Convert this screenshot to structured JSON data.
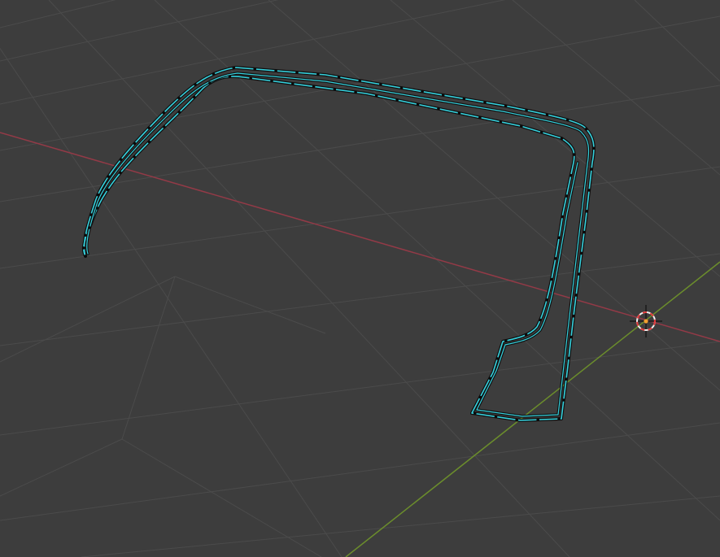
{
  "viewport": {
    "view": "3d-viewport",
    "mode": "edit",
    "selection": "all-edges-selected"
  },
  "colors": {
    "background": "#3d3d3d",
    "grid_line": "#4b4b4b",
    "x_axis": "#933a47",
    "y_axis": "#6b8d2c",
    "selected_edge": "#36d0dc",
    "edge_outline": "#101010",
    "vertex": "#0b0b0b",
    "cursor_ring_red": "#e23a3a",
    "cursor_ring_white": "#f0f0f0",
    "cursor_center": "#f0a030",
    "cursor_crosshair": "#1a1a1a"
  },
  "icons": {
    "cursor": "3d-cursor-icon"
  }
}
